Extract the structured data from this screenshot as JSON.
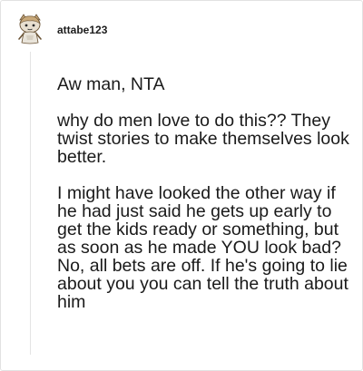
{
  "comment": {
    "username": "attabe123",
    "paragraphs": [
      "Aw man, NTA",
      "why do men love to do this?? They twist stories to make themselves look better.",
      "I might have looked the other way if he had just said he gets up early to get the kids ready or something, but as soon as he made YOU look bad? No, all bets are off. If he's going to lie about you you can tell the truth about him"
    ],
    "avatar_icon": "snoo-avatar-icon",
    "colors": {
      "text": "#1a1a1a",
      "border": "#e2e2e2",
      "thread_line": "#e4e4e4"
    }
  }
}
